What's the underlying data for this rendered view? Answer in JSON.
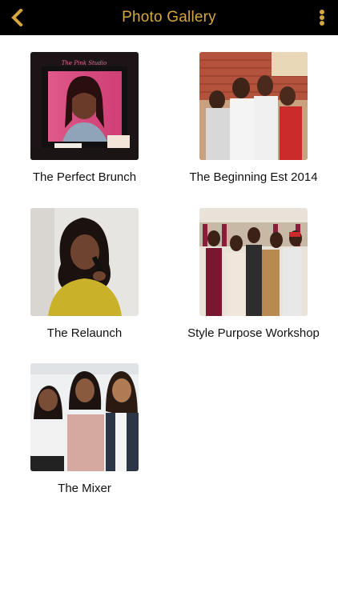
{
  "header": {
    "title": "Photo Gallery",
    "back_icon": "chevron-left-icon",
    "menu_icon": "more-vertical-icon",
    "accent_color": "#d6a640",
    "bar_color": "#000000"
  },
  "albums": [
    {
      "caption": "The Perfect Brunch",
      "photo_text": "The Pink Studio"
    },
    {
      "caption": "The Beginning Est 2014"
    },
    {
      "caption": "The Relaunch"
    },
    {
      "caption": "Style Purpose Workshop"
    },
    {
      "caption": "The Mixer"
    }
  ]
}
